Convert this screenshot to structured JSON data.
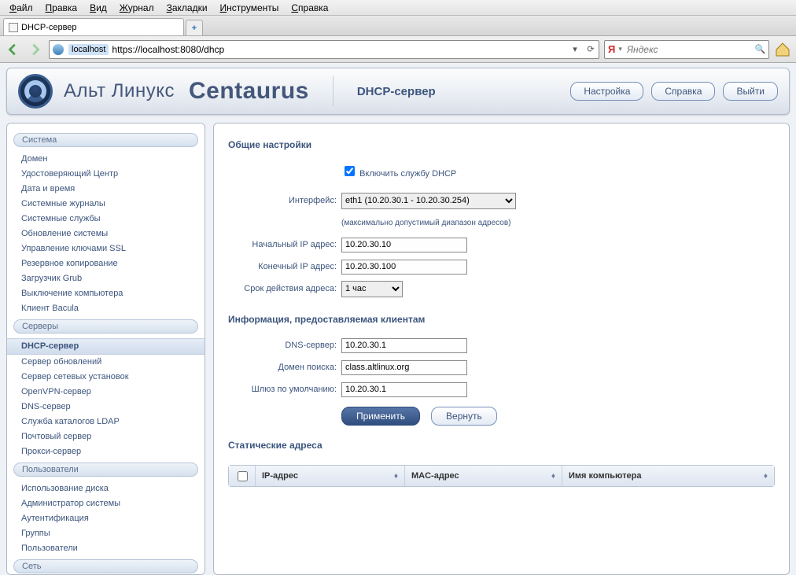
{
  "browser": {
    "menus": [
      "Файл",
      "Правка",
      "Вид",
      "Журнал",
      "Закладки",
      "Инструменты",
      "Справка"
    ],
    "tab_title": "DHCP-сервер",
    "url_host_badge": "localhost",
    "url": "https://localhost:8080/dhcp",
    "search_engine": "Я",
    "search_placeholder": "Яндекс"
  },
  "header": {
    "brand1": "Альт Линукс",
    "brand2": "Centaurus",
    "page_title": "DHCP-сервер",
    "buttons": {
      "config": "Настройка",
      "help": "Справка",
      "logout": "Выйти"
    }
  },
  "sidebar": {
    "groups": [
      {
        "title": "Система",
        "items": [
          "Домен",
          "Удостоверяющий Центр",
          "Дата и время",
          "Системные журналы",
          "Системные службы",
          "Обновление системы",
          "Управление ключами SSL",
          "Резервное копирование",
          "Загрузчик Grub",
          "Выключение компьютера",
          "Клиент Bacula"
        ]
      },
      {
        "title": "Серверы",
        "items": [
          "DHCP-сервер",
          "Сервер обновлений",
          "Сервер сетевых установок",
          "OpenVPN-сервер",
          "DNS-сервер",
          "Служба каталогов LDAP",
          "Почтовый сервер",
          "Прокси-сервер"
        ]
      },
      {
        "title": "Пользователи",
        "items": [
          "Использование диска",
          "Администратор системы",
          "Аутентификация",
          "Группы",
          "Пользователи"
        ]
      },
      {
        "title": "Сеть",
        "items": []
      }
    ],
    "active": "DHCP-сервер"
  },
  "form": {
    "section_general": "Общие настройки",
    "enable_label": "Включить службу DHCP",
    "enable_checked": true,
    "interface_label": "Интерфейс:",
    "interface_value": "eth1 (10.20.30.1 - 10.20.30.254)",
    "range_note": "(максимально допустимый диапазон адресов)",
    "start_ip_label": "Начальный IP адрес:",
    "start_ip": "10.20.30.10",
    "end_ip_label": "Конечный IP адрес:",
    "end_ip": "10.20.30.100",
    "lease_label": "Срок действия адреса:",
    "lease_value": "1 час",
    "section_client": "Информация, предоставляемая клиентам",
    "dns_label": "DNS-сервер:",
    "dns": "10.20.30.1",
    "domain_label": "Домен поиска:",
    "domain": "class.altlinux.org",
    "gateway_label": "Шлюз по умолчанию:",
    "gateway": "10.20.30.1",
    "apply": "Применить",
    "revert": "Вернуть",
    "section_static": "Статические адреса"
  },
  "table": {
    "cols": {
      "ip": "IP-адрес",
      "mac": "MAC-адрес",
      "host": "Имя компьютера"
    }
  }
}
